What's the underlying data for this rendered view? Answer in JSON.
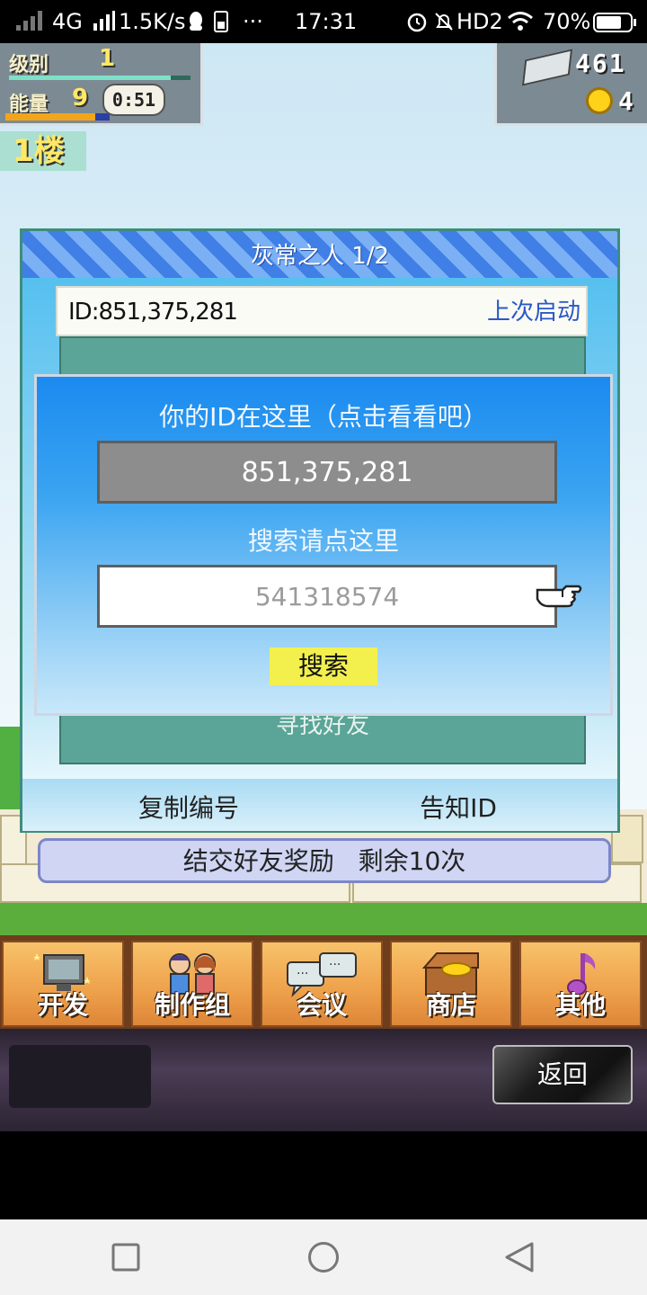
{
  "status_bar": {
    "network": "4G",
    "speed": "1.5K/s",
    "dots": "···",
    "time": "17:31",
    "hd": "HD2",
    "battery": "70%"
  },
  "hud": {
    "level_label": "级别",
    "level_value": "1",
    "energy_label": "能量",
    "energy_value": "9",
    "energy_timer": "0:51",
    "floor_label": "1楼",
    "money": "461",
    "coins": "4"
  },
  "friend_dialog": {
    "title": "灰常之人 1/2",
    "id_label": "ID:851,375,281",
    "last_start": "上次启动",
    "find_friend": "寻找好友",
    "copy_button": "复制编号",
    "notify_button": "告知ID"
  },
  "reward_bar": "结交好友奖励 剩余10次",
  "search_popup": {
    "title": "你的ID在这里（点击看看吧）",
    "my_id": "851,375,281",
    "search_hint": "搜索请点这里",
    "search_value": "541318574",
    "search_button": "搜索"
  },
  "menu": {
    "items": [
      {
        "label": "开发",
        "icon": "computer-icon"
      },
      {
        "label": "制作组",
        "icon": "team-icon"
      },
      {
        "label": "会议",
        "icon": "chat-bubbles-icon"
      },
      {
        "label": "商店",
        "icon": "treasure-chest-icon"
      },
      {
        "label": "其他",
        "icon": "music-note-icon"
      }
    ]
  },
  "back_button": "返回",
  "nav_bar": {
    "icons": [
      "square-icon",
      "circle-icon",
      "triangle-back-icon"
    ]
  }
}
